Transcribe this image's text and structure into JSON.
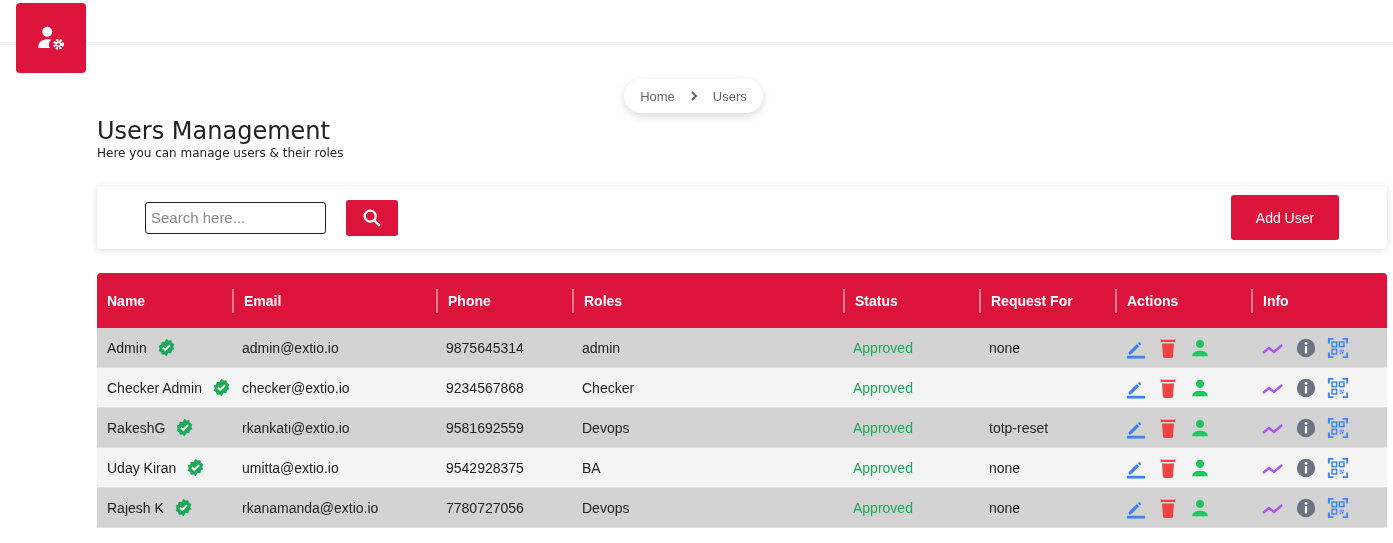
{
  "breadcrumb": [
    {
      "label": "Home"
    },
    {
      "label": "Users"
    }
  ],
  "page": {
    "title": "Users Management",
    "subtitle": "Here you can manage users & their roles"
  },
  "search": {
    "placeholder": "Search here..."
  },
  "add_button": "Add User",
  "table": {
    "columns": [
      "Name",
      "Email",
      "Phone",
      "Roles",
      "Status",
      "Request For",
      "Actions",
      "Info"
    ],
    "rows": [
      {
        "name": "Admin",
        "verified": true,
        "email": "admin@extio.io",
        "phone": "9875645314",
        "roles": "admin",
        "status": "Approved",
        "request_for": "none"
      },
      {
        "name": "Checker Admin",
        "verified": true,
        "email": "checker@extio.io",
        "phone": "9234567868",
        "roles": "Checker",
        "status": "Approved"
      },
      {
        "name": "RakeshG",
        "verified": true,
        "email": "rkankati@extio.io",
        "phone": "9581692559",
        "roles": "Devops",
        "status": "Approved",
        "request_for": "totp-reset"
      },
      {
        "name": "Uday Kiran",
        "verified": true,
        "email": "umitta@extio.io",
        "phone": "9542928375",
        "roles": "BA",
        "status": "Approved",
        "request_for": "none"
      },
      {
        "name": "Rajesh K",
        "verified": true,
        "email": "rkanamanda@extio.io",
        "phone": "7780727056",
        "roles": "Devops",
        "status": "Approved",
        "request_for": "none"
      }
    ]
  }
}
